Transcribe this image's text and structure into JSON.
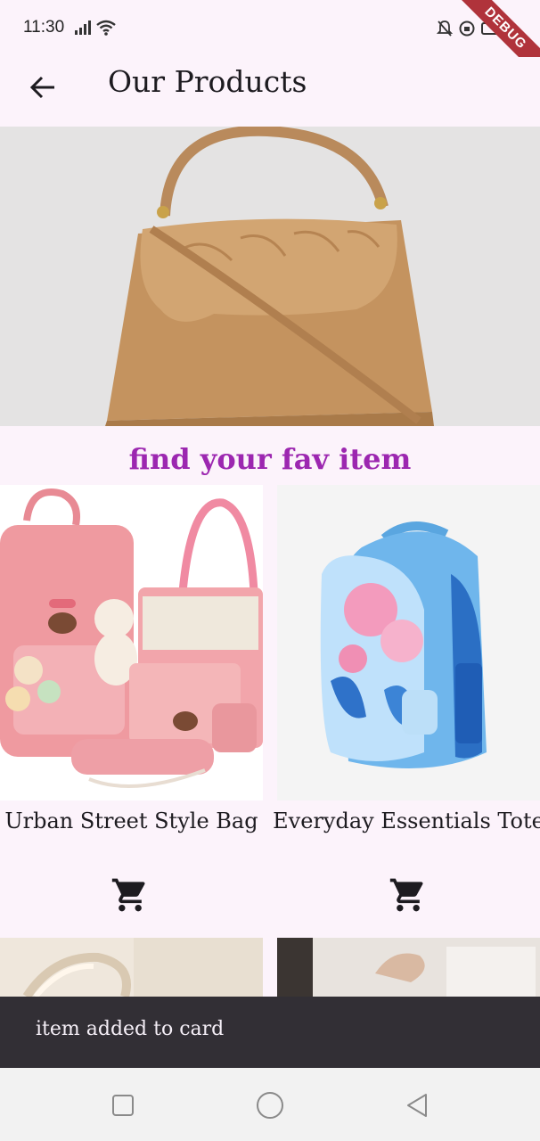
{
  "status_bar": {
    "time": "11:30",
    "debug_label": "DEBUG"
  },
  "app_bar": {
    "title": "Our Products",
    "back_icon": "arrow-back-icon"
  },
  "hero": {
    "image": "tan-leather-handbag-image"
  },
  "section": {
    "title": "find your fav item"
  },
  "products": [
    {
      "name": "Urban Street Style Bag",
      "image": "pink-backpack-set-image",
      "cart_icon": "shopping-cart-icon"
    },
    {
      "name": "Everyday Essentials Tote",
      "image": "blue-floral-backpack-image",
      "cart_icon": "shopping-cart-icon"
    }
  ],
  "snackbar": {
    "message": "item added to card"
  },
  "colors": {
    "background": "#fcf3fb",
    "accent": "#9c27b0",
    "snackbar": "#322f35",
    "debug": "#b0333b"
  }
}
